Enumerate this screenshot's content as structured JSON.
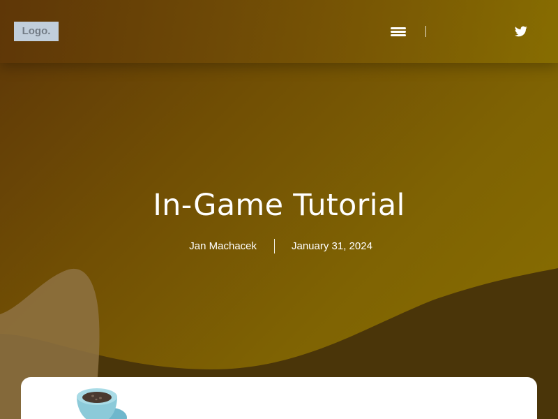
{
  "header": {
    "logo_text": "Logo.",
    "menu_icon": "hamburger-menu-icon",
    "social_icon": "twitter-icon"
  },
  "hero": {
    "title": "In-Game Tutorial",
    "author": "Jan Machacek",
    "date": "January 31, 2024"
  },
  "card": {
    "illustration_icon": "coffee-cup-illustration"
  },
  "colors": {
    "gradient_start": "#5d3608",
    "gradient_end": "#8a7000",
    "wave_dark": "#4a3509",
    "wave_light": "#8e7243",
    "logo_bg": "#c1cedb",
    "card_bg": "#ffffff"
  }
}
